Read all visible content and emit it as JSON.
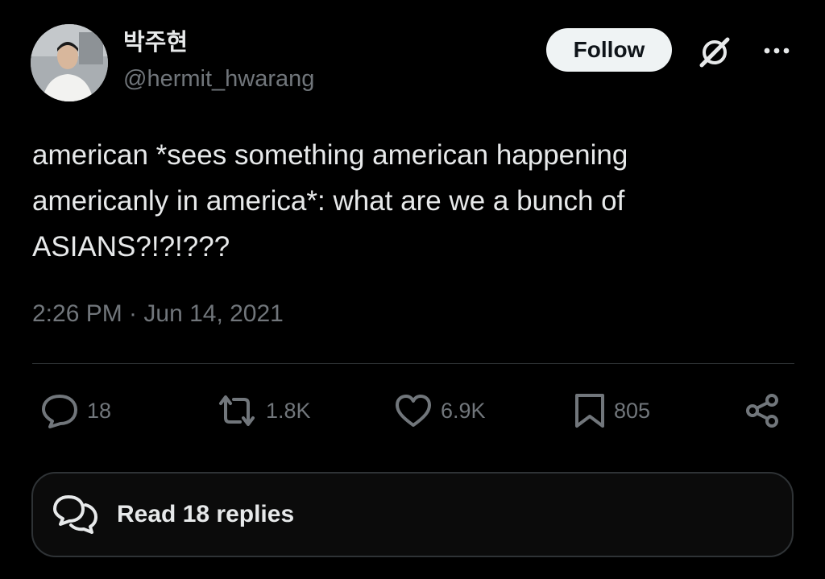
{
  "author": {
    "display_name": "박주현",
    "handle": "@hermit_hwarang",
    "avatar_icon": "avatar-photo"
  },
  "header": {
    "follow_label": "Follow",
    "grok_icon": "grok-icon",
    "more_icon": "more-icon"
  },
  "tweet": {
    "text": "american *sees something american happening\namericanly in america*: what are we a bunch of\nASIANS?!?!???",
    "timestamp": "2:26 PM · Jun 14, 2021"
  },
  "actions": {
    "replies": "18",
    "reposts": "1.8K",
    "likes": "6.9K",
    "bookmarks": "805"
  },
  "read_replies": {
    "label": "Read 18 replies"
  },
  "colors": {
    "background": "#000000",
    "text": "#e7e9ea",
    "secondary": "#71767b",
    "divider": "#2f3336",
    "button_bg": "#eff3f4"
  }
}
